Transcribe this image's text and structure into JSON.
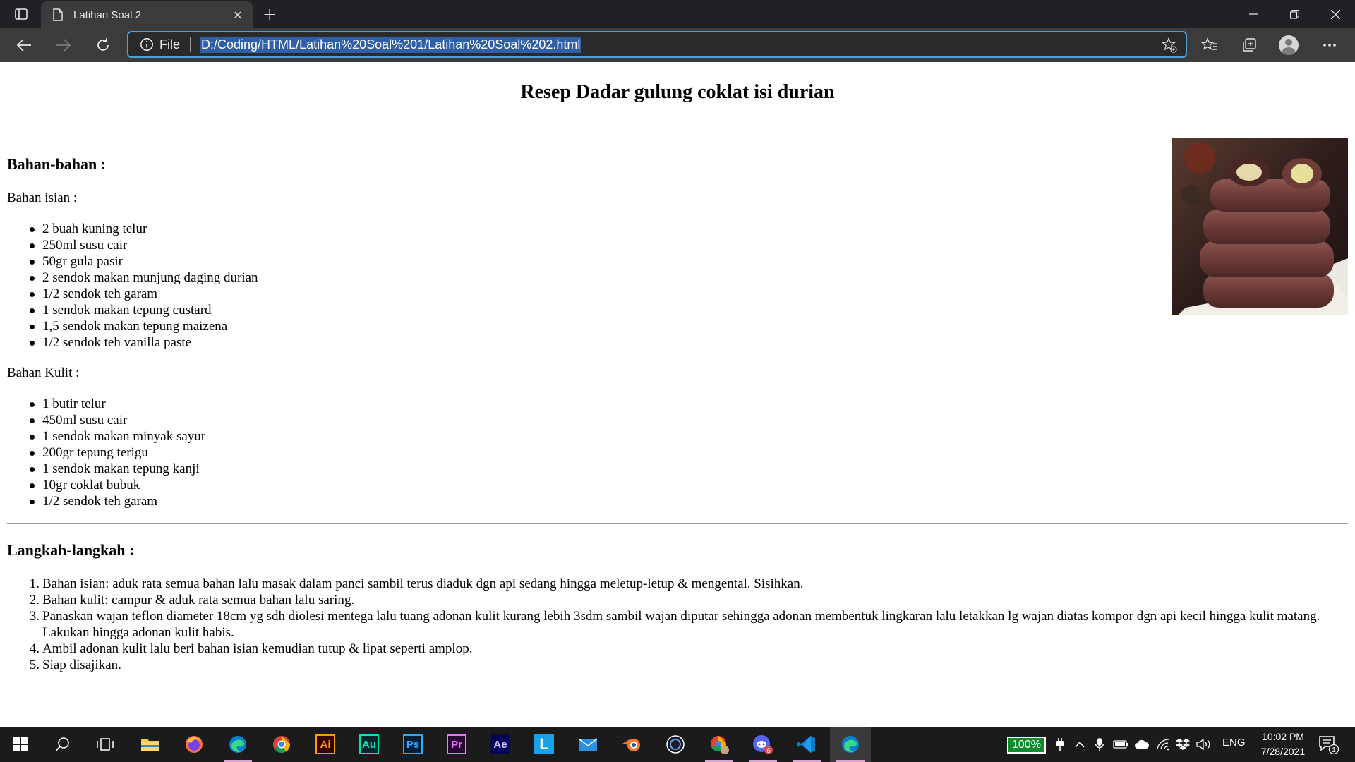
{
  "browser": {
    "tab_title": "Latihan Soal 2",
    "address_scheme": "File",
    "url": "D:/Coding/HTML/Latihan%20Soal%201/Latihan%20Soal%202.html"
  },
  "page": {
    "title": "Resep Dadar gulung coklat isi durian",
    "ingredients_heading": "Bahan-bahan :",
    "filling_label": "Bahan isian :",
    "filling_items": [
      "2 buah kuning telur",
      "250ml susu cair",
      "50gr gula pasir",
      "2 sendok makan munjung daging durian",
      "1/2 sendok teh garam",
      "1 sendok makan tepung custard",
      "1,5 sendok makan tepung maizena",
      "1/2 sendok teh vanilla paste"
    ],
    "skin_label": "Bahan Kulit :",
    "skin_items": [
      "1 butir telur",
      "450ml susu cair",
      "1 sendok makan minyak sayur",
      "200gr tepung terigu",
      "1 sendok makan tepung kanji",
      "10gr coklat bubuk",
      "1/2 sendok teh garam"
    ],
    "steps_heading": "Langkah-langkah :",
    "step_numbers": [
      "1.",
      "2.",
      "3.",
      "4.",
      "5."
    ],
    "steps": [
      "Bahan isian: aduk rata semua bahan lalu masak dalam panci sambil terus diaduk dgn api sedang hingga meletup-letup & mengental. Sisihkan.",
      "Bahan kulit: campur & aduk rata semua bahan lalu saring.",
      "Panaskan wajan teflon diameter 18cm yg sdh diolesi mentega lalu tuang adonan kulit kurang lebih 3sdm sambil wajan diputar sehingga adonan membentuk lingkaran lalu letakkan lg wajan diatas kompor dgn api kecil hingga kulit matang. Lakukan hingga adonan kulit habis.",
      "Ambil adonan kulit lalu beri bahan isian kemudian tutup & lipat seperti amplop.",
      "Siap disajikan."
    ]
  },
  "taskbar": {
    "apps": [
      "Ai",
      "Au",
      "Ps",
      "Pr",
      "Ae",
      "L"
    ],
    "battery": "100%",
    "language": "ENG",
    "time": "10:02 PM",
    "date": "7/28/2021",
    "notification_count": "1",
    "badge_count": "6"
  },
  "colors": {
    "titlebar": "#202124",
    "toolbar": "#3b3b3b",
    "address_focus": "#4ea1dd",
    "url_selection": "#2f5fa7",
    "taskbar": "#1b1b1b",
    "battery_green": "#138a2d"
  }
}
